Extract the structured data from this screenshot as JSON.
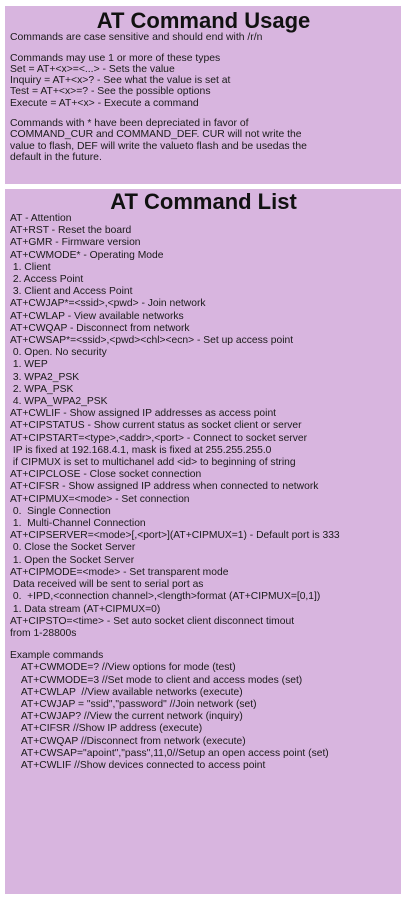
{
  "usage": {
    "title": "AT Command Usage",
    "lines": [
      "Commands are case sensitive and should end with /r/n",
      "",
      "Commands may use 1 or more of these types",
      "Set = AT+<x>=<...> - Sets the value",
      "Inquiry = AT+<x>? - See what the value is set at",
      "Test = AT+<x>=? - See the possible options",
      "Execute = AT+<x> - Execute a command",
      "",
      "Commands with * have been depreciated in favor of",
      "COMMAND_CUR and COMMAND_DEF. CUR will not write the",
      "value to flash, DEF will write the valueto flash and be usedas the",
      "default in the future."
    ]
  },
  "list": {
    "title": "AT Command List",
    "lines": [
      "AT - Attention",
      "AT+RST - Reset the board",
      "AT+GMR - Firmware version",
      "AT+CWMODE* - Operating Mode",
      " 1. Client",
      " 2. Access Point",
      " 3. Client and Access Point",
      "AT+CWJAP*=<ssid>,<pwd> - Join network",
      "AT+CWLAP - View available networks",
      "AT+CWQAP - Disconnect from network",
      "AT+CWSAP*=<ssid>,<pwd><chl><ecn> - Set up access point",
      " 0. Open. No security",
      " 1. WEP",
      " 3. WPA2_PSK",
      " 2. WPA_PSK",
      " 4. WPA_WPA2_PSK",
      "AT+CWLIF - Show assigned IP addresses as access point",
      "AT+CIPSTATUS - Show current status as socket client or server",
      "AT+CIPSTART=<type>,<addr>,<port> - Connect to socket server",
      " IP is fixed at 192.168.4.1, mask is fixed at 255.255.255.0",
      " if CIPMUX is set to multichanel add <id> to beginning of string",
      "AT+CIPCLOSE - Close socket connection",
      "AT+CIFSR - Show assigned IP address when connected to network",
      "AT+CIPMUX=<mode> - Set connection",
      " 0.  Single Connection",
      " 1.  Multi-Channel Connection",
      "AT+CIPSERVER=<mode>[,<port>](AT+CIPMUX=1) - Default port is 333",
      " 0. Close the Socket Server",
      " 1. Open the Socket Server",
      "AT+CIPMODE=<mode> - Set transparent mode",
      " Data received will be sent to serial port as",
      " 0.  +IPD,<connection channel>,<length>format (AT+CIPMUX=[0,1])",
      " 1. Data stream (AT+CIPMUX=0)",
      "AT+CIPSTO=<time> - Set auto socket client disconnect timout",
      "from 1-28800s",
      "",
      "Example commands",
      "    AT+CWMODE=? //View options for mode (test)",
      "    AT+CWMODE=3 //Set mode to client and access modes (set)",
      "    AT+CWLAP  //View available networks (execute)",
      "    AT+CWJAP = \"ssid\",\"password\" //Join network (set)",
      "    AT+CWJAP? //View the current network (inquiry)",
      "    AT+CIFSR //Show IP address (execute)",
      "    AT+CWQAP //Disconnect from network (execute)",
      "    AT+CWSAP=\"apoint\",\"pass\",11,0//Setup an open access point (set)",
      "    AT+CWLIF //Show devices connected to access point"
    ]
  },
  "colors": {
    "panel": "#d8b5df",
    "text": "#1a1a1a"
  }
}
